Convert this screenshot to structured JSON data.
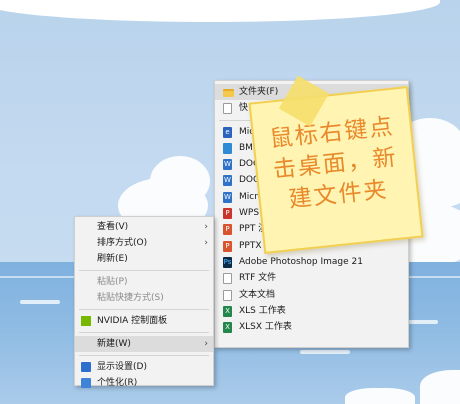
{
  "context_menu": {
    "items": [
      {
        "label": "查看(V)",
        "submenu": true,
        "enabled": true
      },
      {
        "label": "排序方式(O)",
        "submenu": true,
        "enabled": true
      },
      {
        "label": "刷新(E)",
        "submenu": false,
        "enabled": true
      },
      {
        "label": "粘贴(P)",
        "submenu": false,
        "enabled": false
      },
      {
        "label": "粘贴快捷方式(S)",
        "submenu": false,
        "enabled": false
      },
      {
        "label": "NVIDIA 控制面板",
        "icon": "nvidia-icon",
        "enabled": true
      },
      {
        "label": "新建(W)",
        "submenu": true,
        "enabled": true,
        "highlighted": true
      },
      {
        "label": "显示设置(D)",
        "icon": "display-icon",
        "enabled": true
      },
      {
        "label": "个性化(R)",
        "icon": "personalize-icon",
        "enabled": true
      }
    ],
    "arrow": "›"
  },
  "new_submenu": {
    "items": [
      {
        "label": "文件夹(F)",
        "icon": "folder-icon",
        "highlighted": true
      },
      {
        "label": "快",
        "icon": "shortcut-icon"
      },
      {
        "label": "",
        "icon": "blank-icon"
      },
      {
        "label": "Micr",
        "icon": "word-icon"
      },
      {
        "label": "BMP",
        "icon": "bmp-icon"
      },
      {
        "label": "DOC",
        "icon": "doc-icon"
      },
      {
        "label": "DOCX",
        "icon": "docx-icon"
      },
      {
        "label": "Micro",
        "icon": "word-doc-icon"
      },
      {
        "label": "WPS P",
        "icon": "wps-icon"
      },
      {
        "label": "PPT 演",
        "icon": "ppt-icon"
      },
      {
        "label": "PPTX",
        "icon": "pptx-icon"
      },
      {
        "label": "Adobe Photoshop Image 21",
        "icon": "photoshop-icon"
      },
      {
        "label": "RTF 文件",
        "icon": "rtf-icon"
      },
      {
        "label": "文本文档",
        "icon": "text-document-icon"
      },
      {
        "label": "XLS 工作表",
        "icon": "xls-icon"
      },
      {
        "label": "XLSX 工作表",
        "icon": "xlsx-icon"
      }
    ]
  },
  "sticky_note": {
    "text": "鼠标右键点击桌面，新建文件夹",
    "line1": "鼠标右键点",
    "line2": "击桌面，新",
    "line3": "建文件夹"
  },
  "colors": {
    "menu_bg": "#f2f2f2",
    "highlight": "#dcdcdc",
    "disabled_text": "#8a8a8a",
    "note_text": "#e8892c",
    "note_bg": "#fff4b2"
  }
}
